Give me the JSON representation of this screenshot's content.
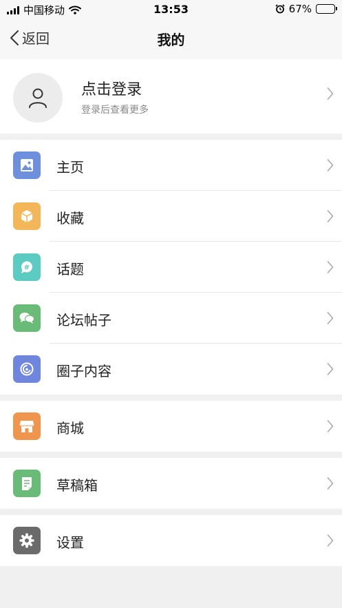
{
  "status_bar": {
    "carrier": "中国移动",
    "time": "13:53",
    "battery_percent": "67%",
    "battery_level": 0.67
  },
  "navbar": {
    "back_label": "返回",
    "title": "我的"
  },
  "profile": {
    "title": "点击登录",
    "subtitle": "登录后查看更多"
  },
  "groups": [
    [
      {
        "label": "主页",
        "icon": "image-icon",
        "color": "#6e8fdc"
      },
      {
        "label": "收藏",
        "icon": "box-icon",
        "color": "#f3b75a"
      },
      {
        "label": "话题",
        "icon": "hashtag-bubble-icon",
        "color": "#5ccbc2"
      },
      {
        "label": "论坛帖子",
        "icon": "chat-bubbles-icon",
        "color": "#6bbb78"
      },
      {
        "label": "圈子内容",
        "icon": "circle-swirl-icon",
        "color": "#6f86dc"
      }
    ],
    [
      {
        "label": "商城",
        "icon": "store-icon",
        "color": "#f0954d"
      }
    ],
    [
      {
        "label": "草稿箱",
        "icon": "draft-document-icon",
        "color": "#6bbb78"
      }
    ],
    [
      {
        "label": "设置",
        "icon": "gear-icon",
        "color": "#6b6b6b"
      }
    ]
  ]
}
